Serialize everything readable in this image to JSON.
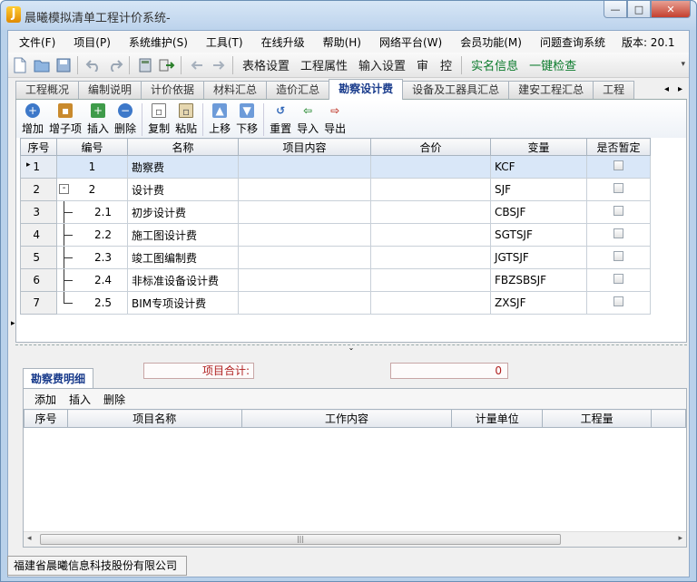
{
  "window": {
    "title": "晨曦模拟清单工程计价系统-",
    "logo_letter": "J",
    "minimize": "—",
    "maximize": "□",
    "close": "✕"
  },
  "menu": {
    "items": [
      "文件(F)",
      "项目(P)",
      "系统维护(S)",
      "工具(T)",
      "在线升级",
      "帮助(H)",
      "网络平台(W)",
      "会员功能(M)",
      "问题查询系统"
    ],
    "version": "版本: 20.1"
  },
  "toolbar": {
    "icons": [
      "new-file-icon",
      "open-folder-icon",
      "save-icon",
      "undo-icon",
      "redo-icon",
      "calculator-icon",
      "exit-icon",
      "left-arrow-icon",
      "right-arrow-icon"
    ],
    "text_buttons": [
      "表格设置",
      "工程属性",
      "输入设置",
      "审　控"
    ],
    "green_buttons": [
      "实名信息",
      "一键检查"
    ]
  },
  "tabs": [
    "工程概况",
    "编制说明",
    "计价依据",
    "材料汇总",
    "造价汇总",
    "勘察设计费",
    "设备及工器具汇总",
    "建安工程汇总",
    "工程"
  ],
  "active_tab": "勘察设计费",
  "subtoolbar": {
    "buttons": [
      "增加",
      "增子项",
      "插入",
      "删除",
      "复制",
      "粘贴",
      "上移",
      "下移",
      "重置",
      "导入",
      "导出"
    ]
  },
  "grid": {
    "columns": [
      "序号",
      "编号",
      "名称",
      "项目内容",
      "合价",
      "变量",
      "是否暂定"
    ],
    "rows": [
      {
        "seq": "1",
        "code": "1",
        "name": "勘察费",
        "content": "",
        "total": "",
        "var": "KCF",
        "selected": true
      },
      {
        "seq": "2",
        "code": "2",
        "name": "设计费",
        "content": "",
        "total": "",
        "var": "SJF",
        "selected": false
      },
      {
        "seq": "3",
        "code": "2.1",
        "name": "初步设计费",
        "content": "",
        "total": "",
        "var": "CBSJF",
        "selected": false
      },
      {
        "seq": "4",
        "code": "2.2",
        "name": "施工图设计费",
        "content": "",
        "total": "",
        "var": "SGTSJF",
        "selected": false
      },
      {
        "seq": "5",
        "code": "2.3",
        "name": "竣工图编制费",
        "content": "",
        "total": "",
        "var": "JGTSJF",
        "selected": false
      },
      {
        "seq": "6",
        "code": "2.4",
        "name": "非标准设备设计费",
        "content": "",
        "total": "",
        "var": "FBZSBSJF",
        "selected": false
      },
      {
        "seq": "7",
        "code": "2.5",
        "name": "BIM专项设计费",
        "content": "",
        "total": "",
        "var": "ZXSJF",
        "selected": false
      }
    ],
    "collapse_symbol": "-",
    "row_indicator": "▸"
  },
  "summary": {
    "label": "项目合计:",
    "value": "0"
  },
  "detail": {
    "tab": "勘察费明细",
    "actions": [
      "添加",
      "插入",
      "删除"
    ],
    "columns": [
      "序号",
      "项目名称",
      "工作内容",
      "计量单位",
      "工程量"
    ]
  },
  "statusbar": {
    "company": "福建省晨曦信息科技股份有限公司"
  },
  "colors": {
    "active_tab_text": "#1a3c8c",
    "total_text": "#b02020",
    "green_text": "#0a7a2b",
    "selected_row": "#d9e7f8"
  }
}
